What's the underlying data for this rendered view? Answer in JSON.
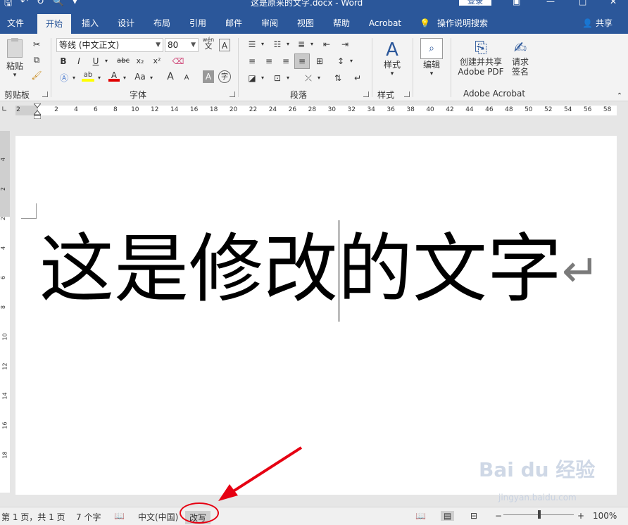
{
  "titlebar": {
    "doc_title": "这是原来的文字.docx  -  Word",
    "login": "登录"
  },
  "tabs": [
    {
      "label": "文件"
    },
    {
      "label": "开始"
    },
    {
      "label": "插入"
    },
    {
      "label": "设计"
    },
    {
      "label": "布局"
    },
    {
      "label": "引用"
    },
    {
      "label": "邮件"
    },
    {
      "label": "审阅"
    },
    {
      "label": "视图"
    },
    {
      "label": "帮助"
    },
    {
      "label": "Acrobat"
    }
  ],
  "tell_me": "操作说明搜索",
  "share": "共享",
  "ribbon": {
    "clipboard": {
      "paste": "粘贴",
      "label": "剪贴板"
    },
    "font": {
      "name": "等线 (中文正文)",
      "size": "80",
      "label": "字体",
      "bold": "B",
      "italic": "I",
      "underline": "U",
      "strike": "abc",
      "subscript": "x₂",
      "superscript": "x²",
      "grow": "A",
      "shrink": "A",
      "case": "Aa",
      "phonetic_top": "wén",
      "phonetic_bottom": "文",
      "border_char": "A",
      "shading_char": "A",
      "enclose_char": "字"
    },
    "paragraph": {
      "label": "段落"
    },
    "styles": {
      "button": "样式",
      "label": "样式"
    },
    "editing": {
      "button": "编辑"
    },
    "acrobat": {
      "create_line1": "创建并共享",
      "create_line2": "Adobe PDF",
      "sign_line1": "请求",
      "sign_line2": "签名",
      "label": "Adobe Acrobat"
    }
  },
  "ruler": {
    "numbers": [
      "2",
      "2",
      "4",
      "6",
      "8",
      "10",
      "12",
      "14",
      "16",
      "18",
      "20",
      "22",
      "24",
      "26",
      "28",
      "30",
      "32",
      "34",
      "36",
      "38",
      "40",
      "42",
      "44",
      "46",
      "48",
      "50",
      "52",
      "54",
      "56",
      "58"
    ],
    "vnumbers": [
      "4",
      "2",
      "2",
      "4",
      "6",
      "8",
      "10",
      "12",
      "14",
      "16",
      "18"
    ]
  },
  "document": {
    "text": "这是修改的文字",
    "paragraph_mark": "↵"
  },
  "status": {
    "page": "第 1 页，共 1 页",
    "words": "7 个字",
    "language": "中文(中国)",
    "overtype": "改写",
    "zoom": "100%",
    "zoom_minus": "−",
    "zoom_plus": "+"
  },
  "watermark": {
    "main": "Bai du 经验",
    "sub": "jingyan.baidu.com"
  },
  "colors": {
    "brand": "#2b579a",
    "annotation": "#e60012"
  }
}
